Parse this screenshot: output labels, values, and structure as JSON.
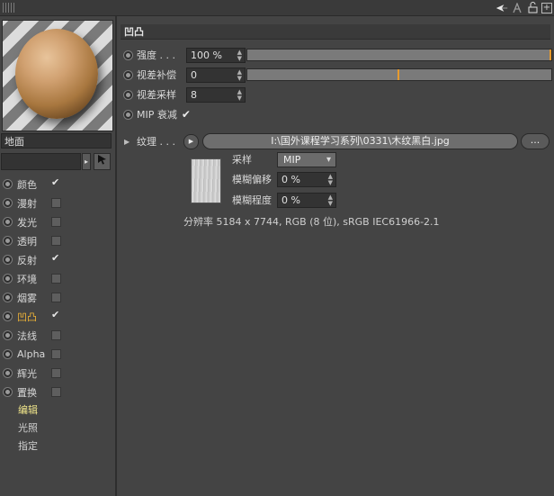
{
  "topbar": {
    "icons": [
      "grip-icon",
      "arrow-nav-icon",
      "text-a-icon",
      "lock-icon",
      "add-icon"
    ],
    "lock_symbol": "🔓",
    "add_symbol": "+"
  },
  "left": {
    "material_name": "地面",
    "search_value": "",
    "channels": [
      {
        "label": "颜色",
        "checked": true
      },
      {
        "label": "漫射",
        "checked": false
      },
      {
        "label": "发光",
        "checked": false
      },
      {
        "label": "透明",
        "checked": false
      },
      {
        "label": "反射",
        "checked": true
      },
      {
        "label": "环境",
        "checked": false
      },
      {
        "label": "烟雾",
        "checked": false
      },
      {
        "label": "凹凸",
        "checked": true,
        "active": true
      },
      {
        "label": "法线",
        "checked": false
      },
      {
        "label": "Alpha",
        "checked": false
      },
      {
        "label": "辉光",
        "checked": false
      },
      {
        "label": "置换",
        "checked": false
      }
    ],
    "sub_items": [
      "编辑",
      "光照",
      "指定"
    ]
  },
  "main": {
    "section_title": "凹凸",
    "params": [
      {
        "label": "强度 . . .",
        "value": "100 %",
        "slider_fraction": 1.0
      },
      {
        "label": "视差补偿",
        "value": "0",
        "slider_fraction": 0.5
      },
      {
        "label": "视差采样",
        "value": "8"
      },
      {
        "label": "MIP 衰减",
        "checked": true
      }
    ],
    "texture": {
      "label": "纹理 . . .",
      "path": "I:\\国外课程学习系列\\0331\\木纹黑白.jpg",
      "more_label": "...",
      "sampling_label": "采样",
      "sampling_value": "MIP",
      "blur_offset_label": "模糊偏移",
      "blur_offset_value": "0 %",
      "blur_scale_label": "模糊程度",
      "blur_scale_value": "0 %",
      "resolution": "分辨率 5184 x 7744, RGB (8 位), sRGB IEC61966-2.1"
    }
  }
}
